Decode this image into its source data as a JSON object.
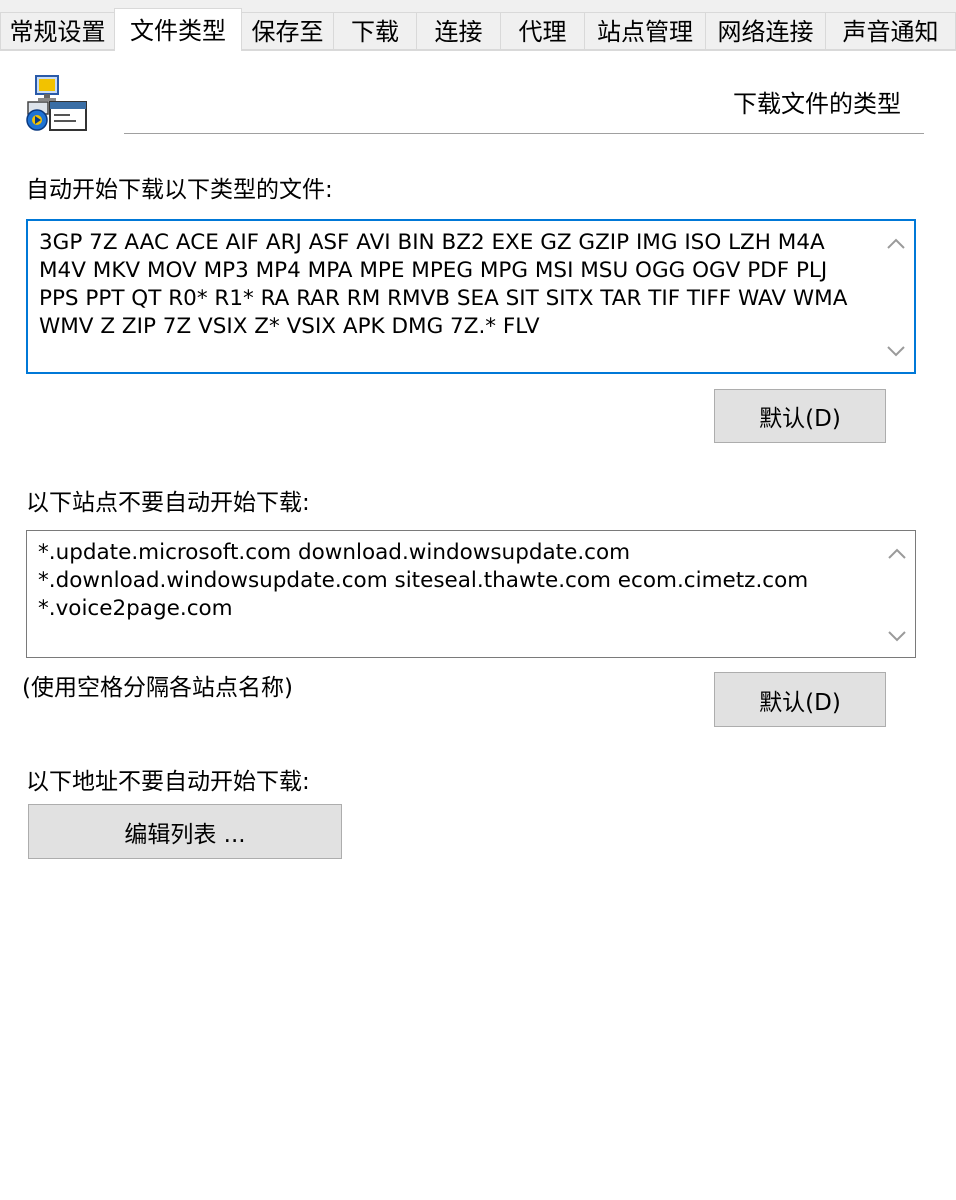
{
  "tabs": [
    {
      "label": "常规设置"
    },
    {
      "label": "文件类型",
      "active": true
    },
    {
      "label": "保存至"
    },
    {
      "label": "下载"
    },
    {
      "label": "连接"
    },
    {
      "label": "代理"
    },
    {
      "label": "站点管理"
    },
    {
      "label": "网络连接"
    },
    {
      "label": "声音通知"
    }
  ],
  "header": {
    "title": "下载文件的类型",
    "icon": "file-types-icon"
  },
  "file_types": {
    "label": "自动开始下载以下类型的文件:",
    "value": "3GP 7Z AAC ACE AIF ARJ ASF AVI BIN BZ2 EXE GZ GZIP IMG ISO LZH M4A M4V MKV MOV MP3 MP4 MPA MPE MPEG MPG MSI MSU OGG OGV PDF PLJ PPS PPT QT R0* R1* RA RAR RM RMVB SEA SIT SITX TAR TIF TIFF WAV WMA WMV Z ZIP 7Z VSIX Z* VSIX APK DMG 7Z.* FLV",
    "default_button": "默认(D)"
  },
  "sites": {
    "label": "以下站点不要自动开始下载:",
    "value": "*.update.microsoft.com download.windowsupdate.com *.download.windowsupdate.com siteseal.thawte.com ecom.cimetz.com *.voice2page.com",
    "hint": "(使用空格分隔各站点名称)",
    "default_button": "默认(D)"
  },
  "addresses": {
    "label": "以下地址不要自动开始下载:",
    "edit_button": "编辑列表 ..."
  },
  "colors": {
    "focus_border": "#0078d7",
    "tab_background": "#f0f0f0",
    "button_background": "#e1e1e1"
  }
}
